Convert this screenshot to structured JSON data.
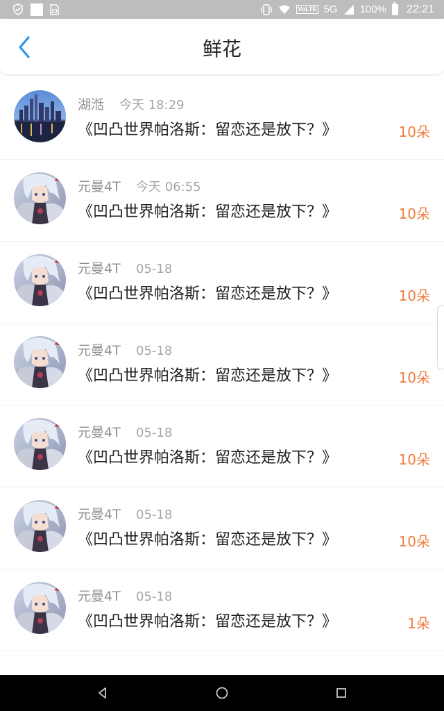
{
  "status_bar": {
    "network": "5G",
    "volte": "VoLTE",
    "battery": "100%",
    "time": "22:21",
    "icons": [
      "shield-icon",
      "notification-icon",
      "sd-card-icon",
      "vibrate-icon",
      "wifi-icon",
      "signal-icon",
      "battery-icon"
    ]
  },
  "header": {
    "title": "鲜花",
    "back_icon": "chevron-left-icon"
  },
  "colors": {
    "accent_blue": "#2f96e6",
    "count_orange": "#f07d3f",
    "name_gray": "#8f8f8f",
    "title_text": "#1e1e1e"
  },
  "items": [
    {
      "user": "湖湉",
      "time": "今天 18:29",
      "title": "《凹凸世界帕洛斯：留恋还是放下？》",
      "count": "10朵",
      "avatar": "city-skyline"
    },
    {
      "user": "元曼4T",
      "time": "今天 06:55",
      "title": "《凹凸世界帕洛斯：留恋还是放下？》",
      "count": "10朵",
      "avatar": "anime-character"
    },
    {
      "user": "元曼4T",
      "time": "05-18",
      "title": "《凹凸世界帕洛斯：留恋还是放下？》",
      "count": "10朵",
      "avatar": "anime-character"
    },
    {
      "user": "元曼4T",
      "time": "05-18",
      "title": "《凹凸世界帕洛斯：留恋还是放下？》",
      "count": "10朵",
      "avatar": "anime-character"
    },
    {
      "user": "元曼4T",
      "time": "05-18",
      "title": "《凹凸世界帕洛斯：留恋还是放下？》",
      "count": "10朵",
      "avatar": "anime-character"
    },
    {
      "user": "元曼4T",
      "time": "05-18",
      "title": "《凹凸世界帕洛斯：留恋还是放下？》",
      "count": "10朵",
      "avatar": "anime-character"
    },
    {
      "user": "元曼4T",
      "time": "05-18",
      "title": "《凹凸世界帕洛斯：留恋还是放下？》",
      "count": "1朵",
      "avatar": "anime-character"
    }
  ],
  "nav": {
    "icons": [
      "back-triangle-icon",
      "home-circle-icon",
      "recents-square-icon"
    ]
  }
}
